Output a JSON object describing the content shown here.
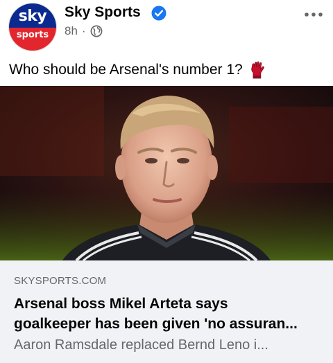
{
  "post": {
    "page_name": "Sky Sports",
    "timestamp": "8h",
    "separator": "·",
    "avatar": {
      "brand_top": "sky",
      "brand_bottom": "sports"
    },
    "caption": "Who should be Arsenal's number 1?",
    "caption_emoji": "goalkeeper-glove-icon",
    "photo_alt": "Footballer in dark kit against a dark red and green stadium background"
  },
  "link_preview": {
    "domain": "SKYSPORTS.COM",
    "title_line1": "Arsenal boss Mikel Arteta says",
    "title_line2": "goalkeeper has been given 'no assuran...",
    "description": "Aaron Ramsdale replaced Bernd Leno i..."
  },
  "colors": {
    "brand_blue": "#0b2a8f",
    "brand_red": "#e3262e",
    "verified_blue": "#1877f2",
    "secondary_text": "#65676b",
    "card_bg": "#f0f2f5"
  }
}
